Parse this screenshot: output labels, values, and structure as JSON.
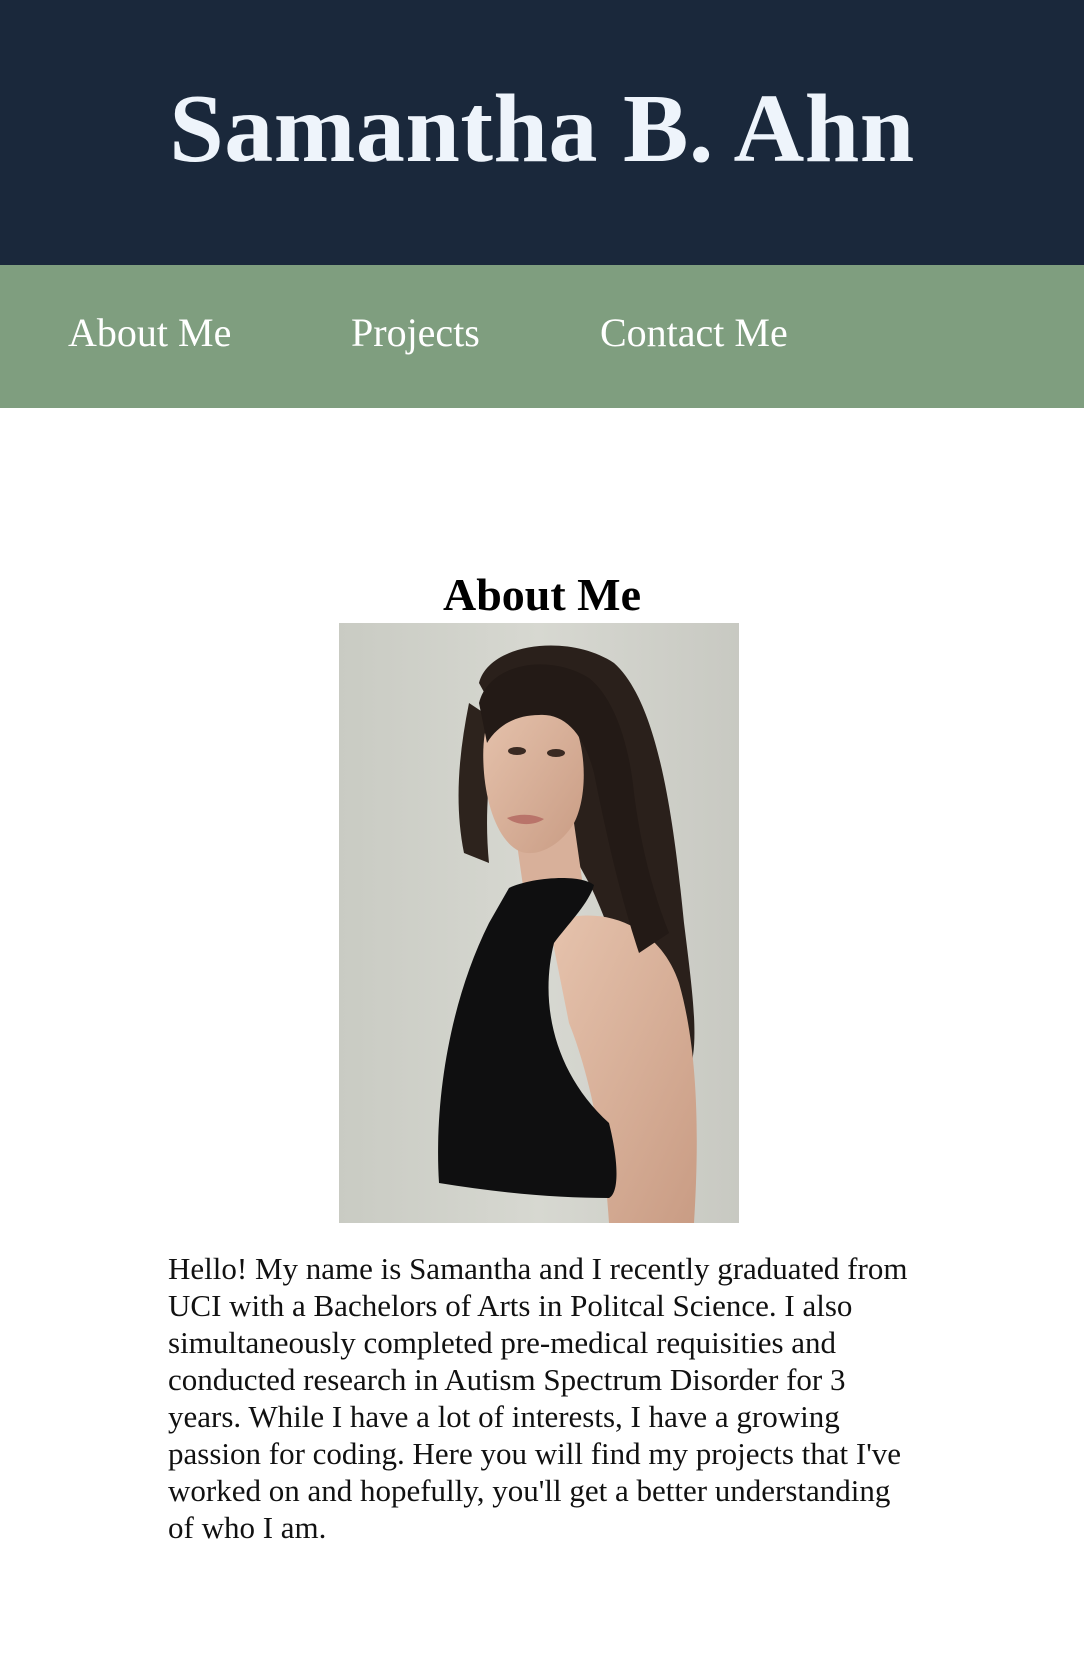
{
  "header": {
    "title": "Samantha B. Ahn"
  },
  "nav": {
    "items": [
      "About Me",
      "Projects",
      "Contact Me"
    ]
  },
  "about": {
    "heading": "About Me",
    "bio": "Hello! My name is Samantha and I recently graduated from UCI with a Bachelors of Arts in Politcal Science. I also simultaneously completed pre-medical requisities and conducted research in Autism Spectrum Disorder for 3 years. While I have a lot of interests, I have a growing passion for coding. Here you will find my projects that I've worked on and hopefully, you'll get a better understanding of who I am."
  },
  "colors": {
    "header_bg": "#1a283b",
    "nav_bg": "#7f9e7f",
    "title_text": "#eef4fb"
  }
}
